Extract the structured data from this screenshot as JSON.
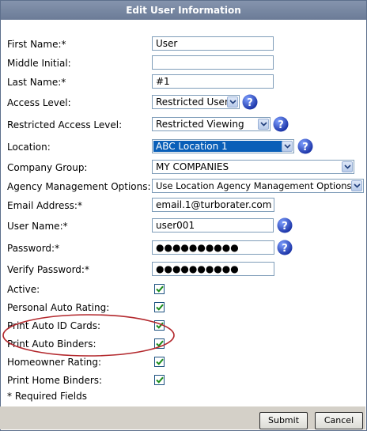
{
  "title": "Edit User Information",
  "fields": {
    "first_name": {
      "label": "First Name:*",
      "value": "User"
    },
    "middle_initial": {
      "label": "Middle Initial:",
      "value": ""
    },
    "last_name": {
      "label": "Last Name:*",
      "value": "#1"
    },
    "access_level": {
      "label": "Access Level:",
      "value": "Restricted User"
    },
    "restricted_access_level": {
      "label": "Restricted Access Level:",
      "value": "Restricted Viewing"
    },
    "location": {
      "label": "Location:",
      "value": "ABC Location 1"
    },
    "company_group": {
      "label": "Company Group:",
      "value": "MY COMPANIES"
    },
    "agency_management": {
      "label": "Agency Management Options:",
      "value": "Use Location Agency Management Options"
    },
    "email": {
      "label": "Email Address:*",
      "value": "email.1@turborater.com"
    },
    "user_name": {
      "label": "User Name:*",
      "value": "user001"
    },
    "password": {
      "label": "Password:*",
      "value": "●●●●●●●●●●"
    },
    "verify_password": {
      "label": "Verify Password:*",
      "value": "●●●●●●●●●●"
    }
  },
  "checkboxes": [
    {
      "label": "Active:",
      "checked": true
    },
    {
      "label": "Personal Auto Rating:",
      "checked": true
    },
    {
      "label": "Print Auto ID Cards:",
      "checked": true
    },
    {
      "label": "Print Auto Binders:",
      "checked": true
    },
    {
      "label": "Homeowner Rating:",
      "checked": true
    },
    {
      "label": "Print Home Binders:",
      "checked": true
    }
  ],
  "required_note": "* Required Fields",
  "buttons": {
    "submit": "Submit",
    "cancel": "Cancel"
  },
  "colors": {
    "titlebar": "#7585a1",
    "highlight_ellipse": "#b3282d",
    "help_icon": "#2f4fb5",
    "check": "#1a8c1a"
  }
}
